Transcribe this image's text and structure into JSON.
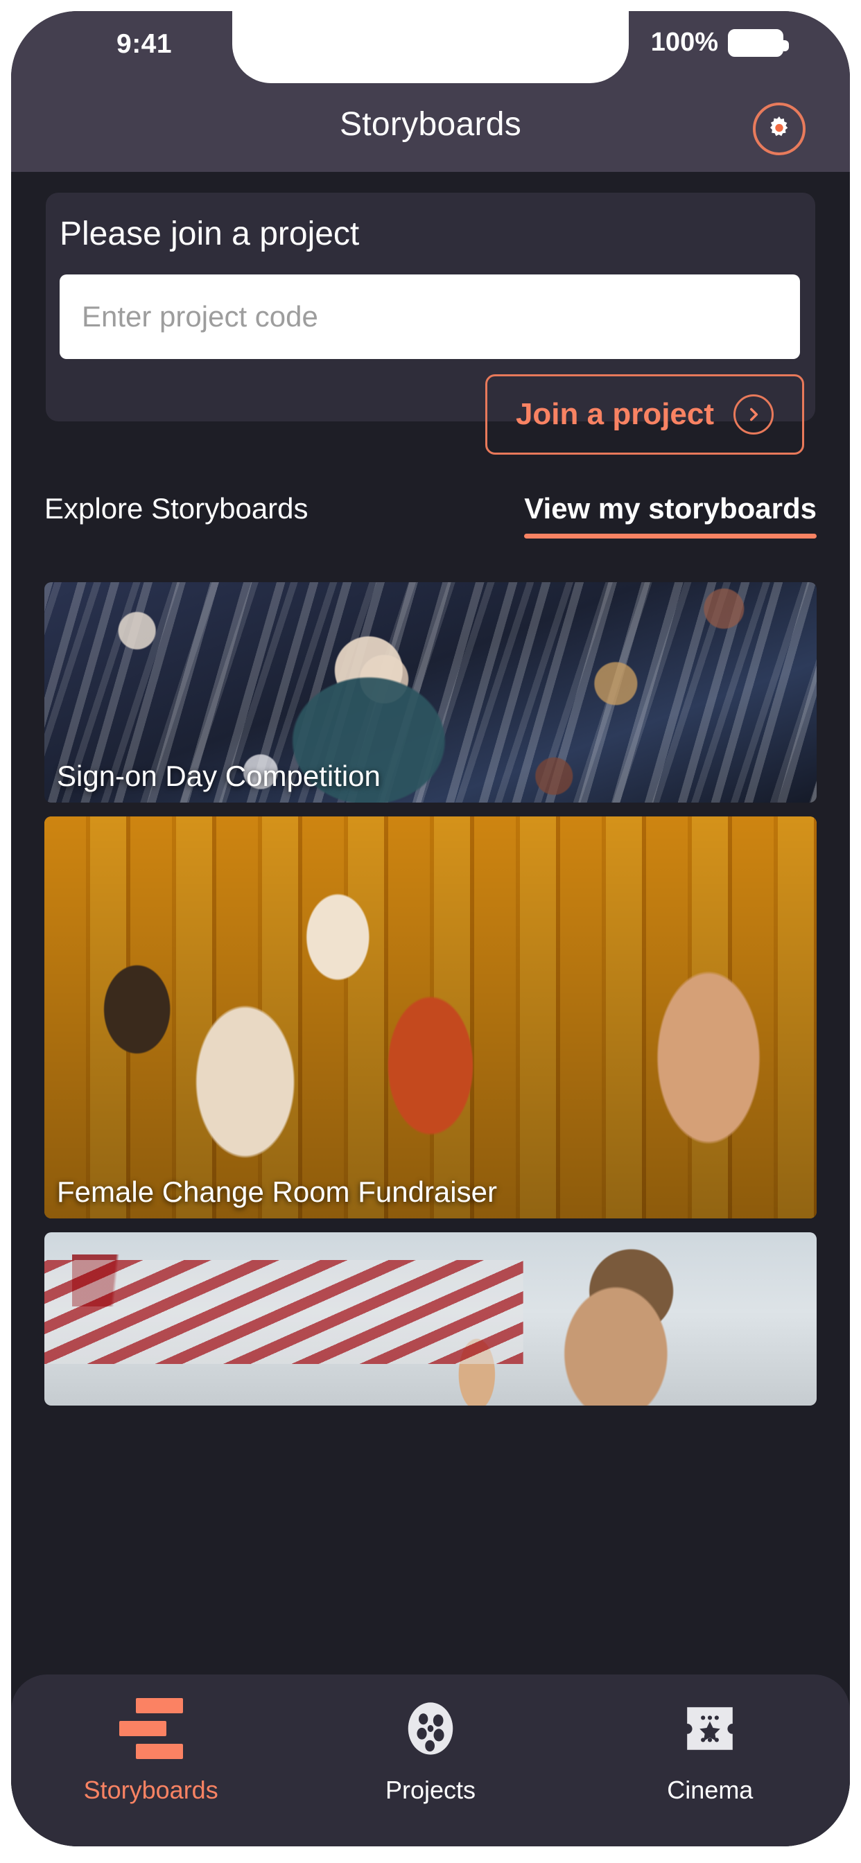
{
  "status_bar": {
    "time": "9:41",
    "battery_percent": "100%",
    "battery_icon": "battery-full-icon"
  },
  "header": {
    "title": "Storyboards",
    "settings_icon": "gear-icon"
  },
  "join_card": {
    "heading": "Please join a project",
    "input_placeholder": "Enter project code",
    "input_value": "",
    "button_label": "Join a project",
    "button_icon": "chevron-right-circle-icon"
  },
  "tabs": [
    {
      "label": "Explore Storyboards",
      "active": false
    },
    {
      "label": "View my storyboards",
      "active": true
    }
  ],
  "storyboards": [
    {
      "title": "Sign-on Day Competition",
      "image": "crowd-of-sports-fans-waving-flags"
    },
    {
      "title": "Female Change Room Fundraiser",
      "image": "women-athletes-in-orange-locker-room"
    },
    {
      "title": "",
      "image": "young-athlete-with-headphones-at-stadium"
    }
  ],
  "bottom_nav": [
    {
      "label": "Storyboards",
      "icon": "bars-icon",
      "active": true
    },
    {
      "label": "Projects",
      "icon": "film-reel-icon",
      "active": false
    },
    {
      "label": "Cinema",
      "icon": "ticket-star-icon",
      "active": false
    }
  ],
  "colors": {
    "accent": "#f98363",
    "accent_border": "#e8795a",
    "background": "#1e1e26",
    "surface": "#2f2d3a",
    "chrome": "#443f4f"
  }
}
